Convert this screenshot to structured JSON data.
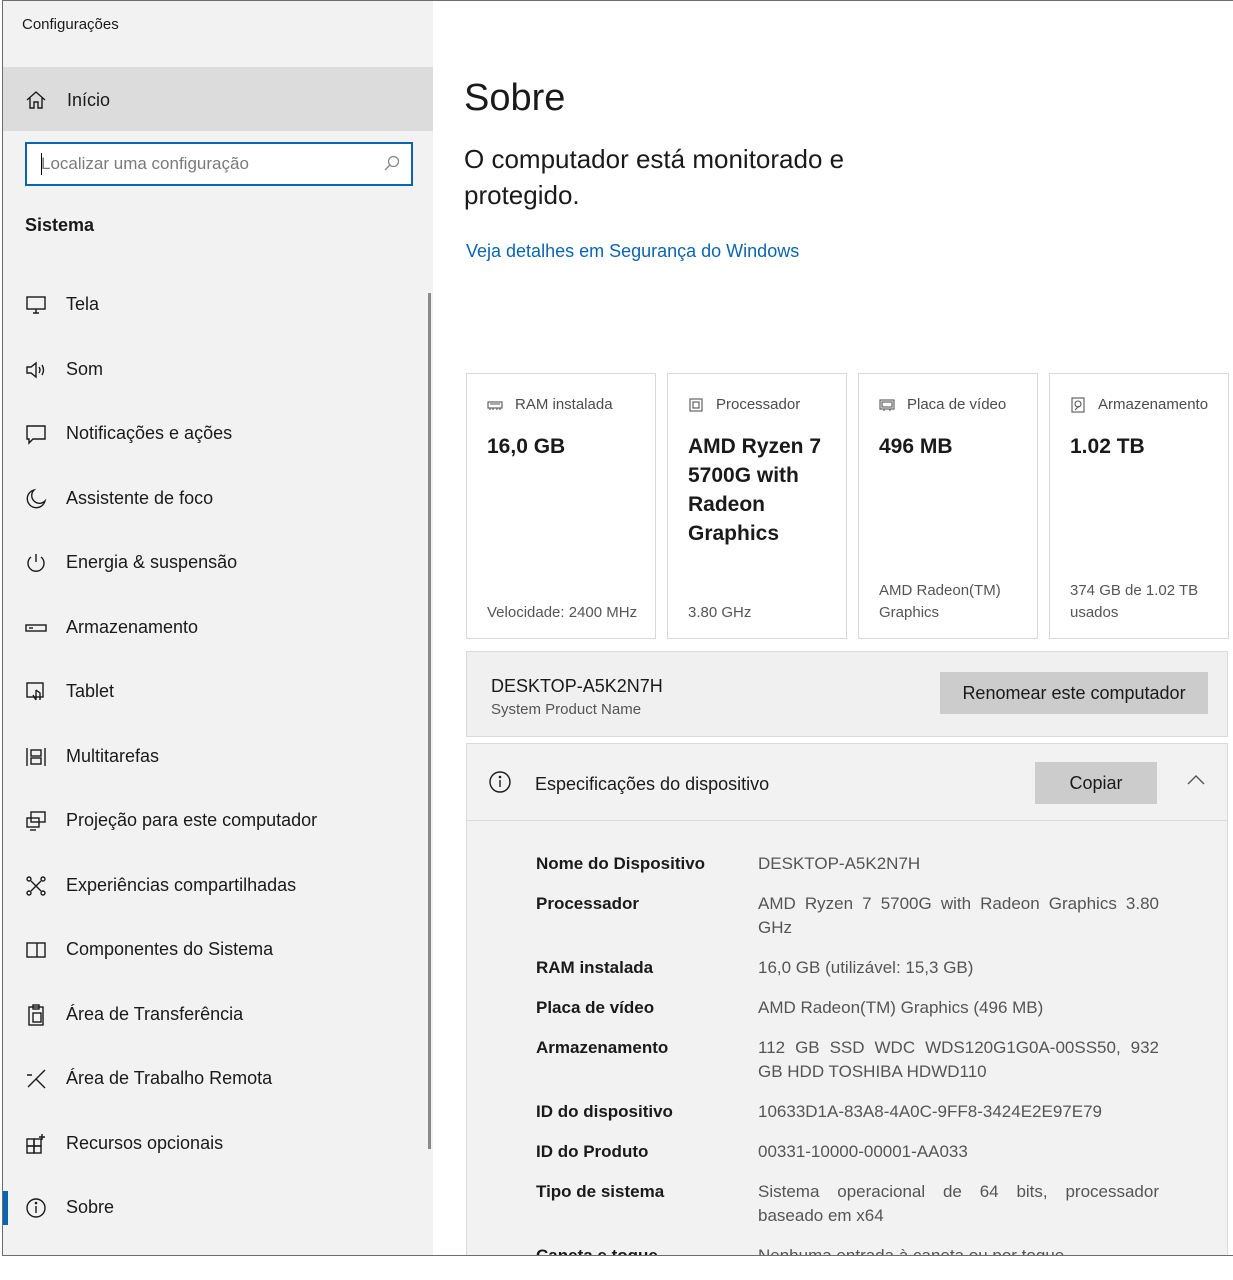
{
  "window": {
    "title": "Configurações"
  },
  "sidebar": {
    "home_label": "Início",
    "search": {
      "placeholder": "Localizar uma configuração"
    },
    "section_title": "Sistema",
    "items": [
      {
        "label": "Tela",
        "icon": "monitor-icon"
      },
      {
        "label": "Som",
        "icon": "speaker-icon"
      },
      {
        "label": "Notificações e ações",
        "icon": "notification-icon"
      },
      {
        "label": "Assistente de foco",
        "icon": "moon-icon"
      },
      {
        "label": "Energia & suspensão",
        "icon": "power-icon"
      },
      {
        "label": "Armazenamento",
        "icon": "storage-icon"
      },
      {
        "label": "Tablet",
        "icon": "tablet-icon"
      },
      {
        "label": "Multitarefas",
        "icon": "multitask-icon"
      },
      {
        "label": "Projeção para este computador",
        "icon": "projection-icon"
      },
      {
        "label": "Experiências compartilhadas",
        "icon": "shared-icon"
      },
      {
        "label": "Componentes do Sistema",
        "icon": "components-icon"
      },
      {
        "label": "Área de Transferência",
        "icon": "clipboard-icon"
      },
      {
        "label": "Área de Trabalho Remota",
        "icon": "remote-desktop-icon"
      },
      {
        "label": "Recursos opcionais",
        "icon": "optional-features-icon"
      },
      {
        "label": "Sobre",
        "icon": "info-icon",
        "active": true
      }
    ]
  },
  "main": {
    "title": "Sobre",
    "protection_text": "O computador está monitorado e protegido.",
    "security_link": "Veja detalhes em Segurança do Windows",
    "cards": [
      {
        "label": "RAM instalada",
        "value": "16,0 GB",
        "sub": "Velocidade: 2400 MHz",
        "icon": "ram-icon"
      },
      {
        "label": "Processador",
        "value": "AMD Ryzen 7 5700G with Radeon Graphics",
        "sub": "3.80 GHz",
        "icon": "cpu-icon"
      },
      {
        "label": "Placa de vídeo",
        "value": "496 MB",
        "sub": "AMD Radeon(TM) Graphics",
        "icon": "gpu-icon"
      },
      {
        "label": "Armazenamento",
        "value": "1.02 TB",
        "sub": "374 GB de 1.02 TB usados",
        "icon": "disk-icon"
      }
    ],
    "computer": {
      "name": "DESKTOP-A5K2N7H",
      "model": "System Product Name",
      "rename_label": "Renomear este computador"
    },
    "specs": {
      "title": "Especificações do dispositivo",
      "copy_label": "Copiar",
      "rows": [
        {
          "key": "Nome do Dispositivo",
          "value": "DESKTOP-A5K2N7H"
        },
        {
          "key": "Processador",
          "value": "AMD Ryzen 7 5700G with Radeon Graphics 3.80 GHz"
        },
        {
          "key": "RAM instalada",
          "value": "16,0 GB (utilizável: 15,3 GB)"
        },
        {
          "key": "Placa de vídeo",
          "value": "AMD Radeon(TM) Graphics (496 MB)"
        },
        {
          "key": "Armazenamento",
          "value": "112 GB SSD WDC WDS120G1G0A-00SS50, 932 GB HDD TOSHIBA HDWD110"
        },
        {
          "key": "ID do dispositivo",
          "value": "10633D1A-83A8-4A0C-9FF8-3424E2E97E79"
        },
        {
          "key": "ID do Produto",
          "value": "00331-10000-00001-AA033"
        },
        {
          "key": "Tipo de sistema",
          "value": "Sistema operacional de 64 bits, processador baseado em x64"
        },
        {
          "key": "Caneta e toque",
          "value": "Nenhuma entrada à caneta ou por toque"
        }
      ]
    }
  }
}
